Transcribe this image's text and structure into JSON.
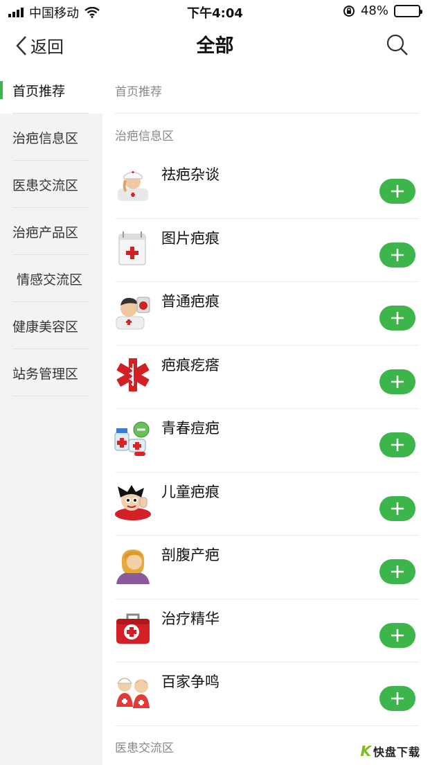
{
  "status_bar": {
    "carrier": "中国移动",
    "time": "下午4:04",
    "battery": "48%",
    "battery_level": 0.48
  },
  "navbar": {
    "back_label": "返回",
    "title": "全部",
    "search_icon": "search-icon"
  },
  "sidebar": {
    "items": [
      {
        "label": "首页推荐",
        "active": true
      },
      {
        "label": "治疤信息区"
      },
      {
        "label": "医患交流区"
      },
      {
        "label": "治疤产品区"
      },
      {
        "label": "情感交流区"
      },
      {
        "label": "健康美容区"
      },
      {
        "label": "站务管理区"
      }
    ]
  },
  "content": {
    "sections": [
      {
        "title": "首页推荐"
      },
      {
        "title": "治疤信息区"
      },
      {
        "title": "医患交流区"
      }
    ],
    "items": [
      {
        "label": "祛疤杂谈",
        "icon": "nurse-icon"
      },
      {
        "label": "图片疤痕",
        "icon": "first-aid-calendar-icon"
      },
      {
        "label": "普通疤痕",
        "icon": "doctor-icon"
      },
      {
        "label": "疤痕疙瘩",
        "icon": "star-of-life-icon"
      },
      {
        "label": "青春痘疤",
        "icon": "medicine-bottles-icon"
      },
      {
        "label": "儿童疤痕",
        "icon": "cartoon-boy-icon"
      },
      {
        "label": "剖腹产疤",
        "icon": "woman-avatar-icon"
      },
      {
        "label": "治疗精华",
        "icon": "first-aid-kit-icon"
      },
      {
        "label": "百家争鸣",
        "icon": "doctors-pair-icon"
      }
    ]
  },
  "colors": {
    "accent": "#3cb54a",
    "sidebar_bg": "#f3f3f3",
    "section_text": "#888888"
  },
  "watermark": {
    "text": "快盘下载"
  }
}
